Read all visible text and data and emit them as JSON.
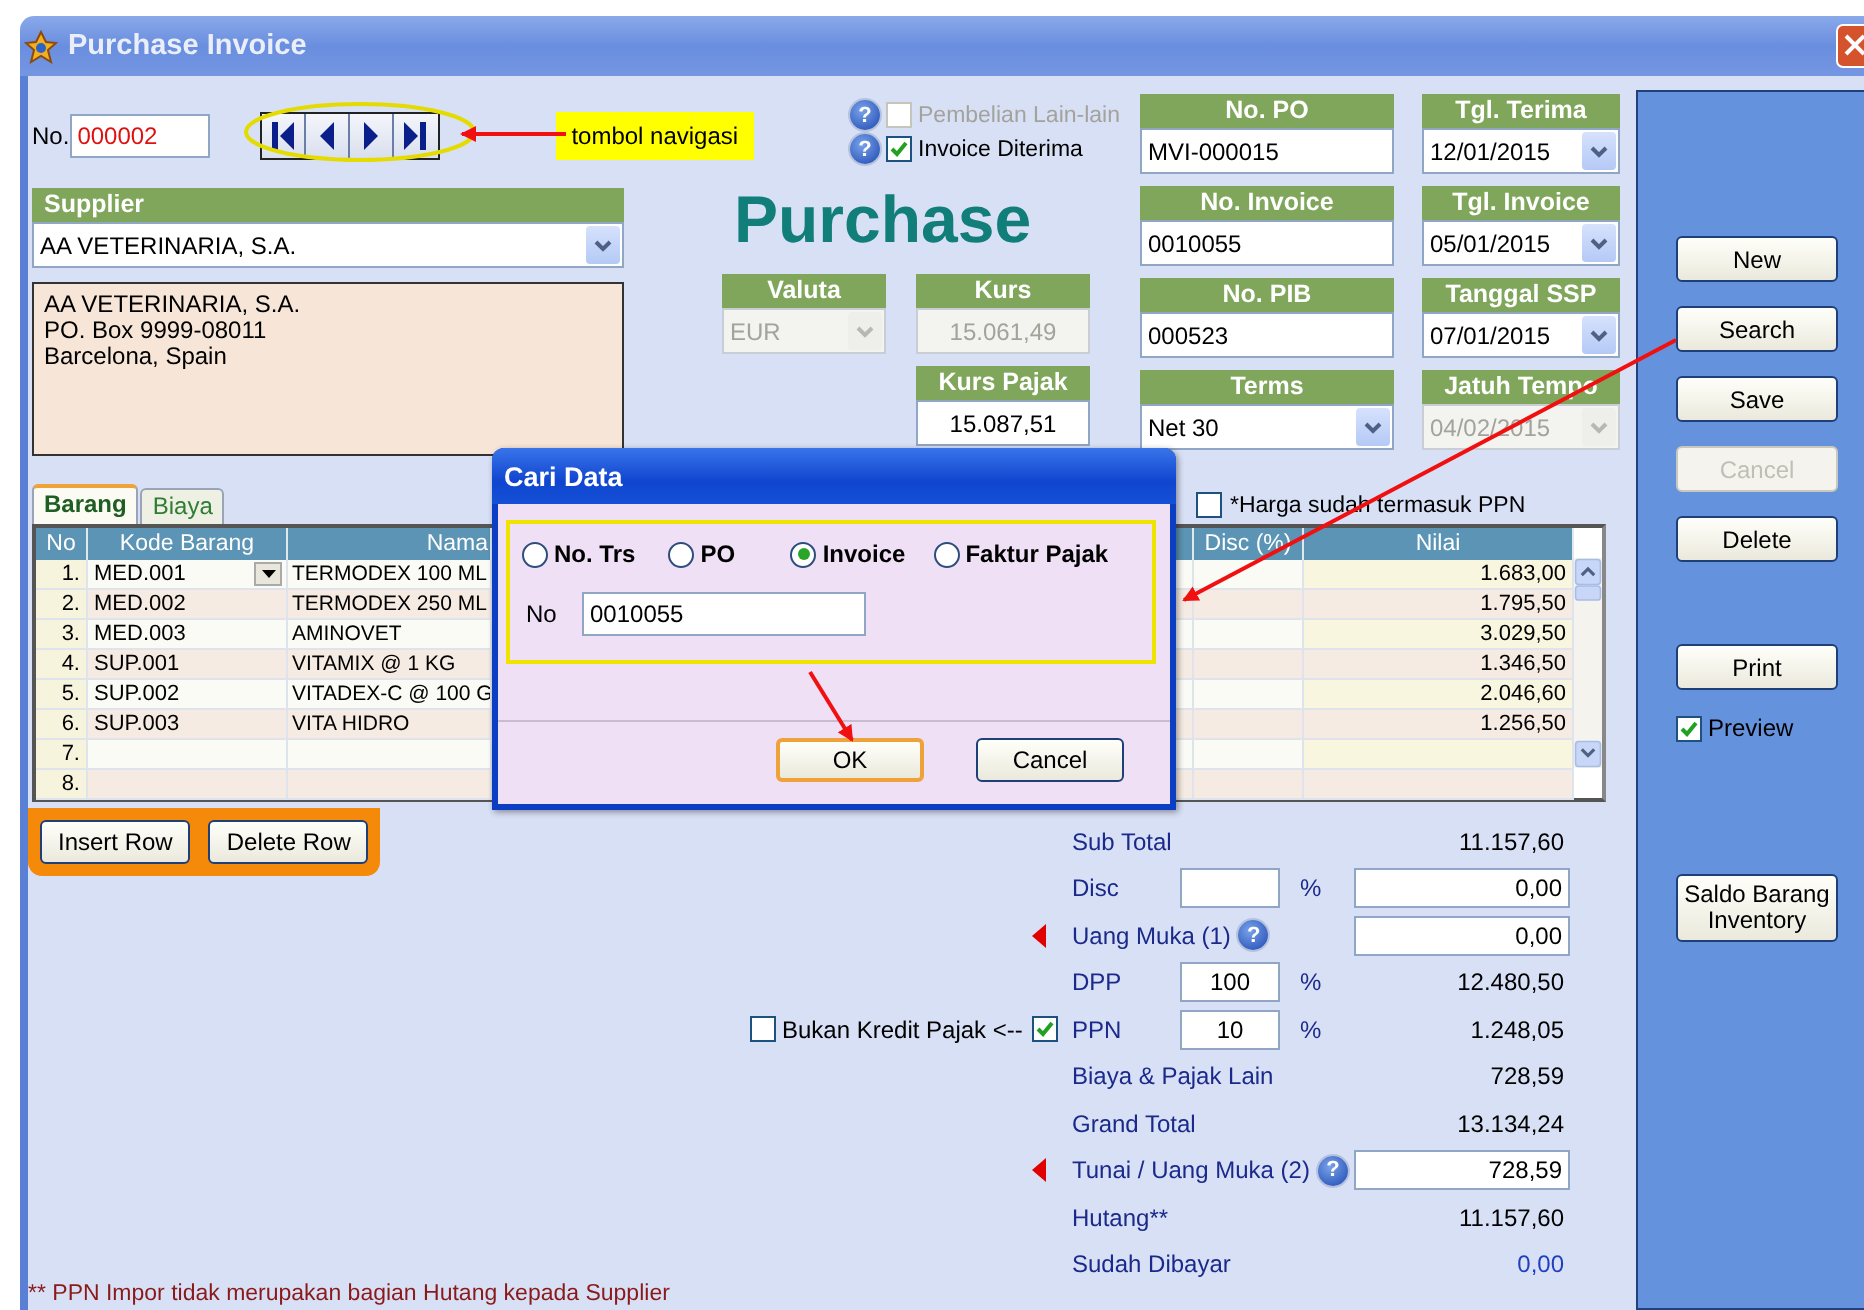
{
  "window": {
    "title": "Purchase Invoice"
  },
  "record": {
    "no_label": "No.",
    "no_value": "000002",
    "nav_note": "tombol navigasi"
  },
  "options": [
    {
      "label": "Pembelian Lain-lain",
      "help": "?",
      "checked": false,
      "disabled": true
    },
    {
      "label": "Invoice Diterima",
      "help": "?",
      "checked": true,
      "disabled": false
    }
  ],
  "supplier": {
    "label": "Supplier",
    "value": "AA VETERINARIA, S.A.",
    "address": [
      "AA VETERINARIA, S.A.",
      "PO. Box 9999-08011",
      "Barcelona, Spain"
    ]
  },
  "form_title": "Purchase",
  "currency_fields": [
    {
      "label": "Valuta",
      "value": "EUR",
      "kind": "select",
      "disabled": true
    },
    {
      "label": "Kurs",
      "value": "15.061,49",
      "kind": "text",
      "disabled": true
    },
    {
      "label": "Kurs Pajak",
      "value": "15.087,51",
      "kind": "text",
      "disabled": false
    }
  ],
  "document_fields": [
    {
      "label": "No. PO",
      "value": "MVI-000015",
      "kind": "text",
      "disabled": false
    },
    {
      "label": "No. Invoice",
      "value": "0010055",
      "kind": "text",
      "disabled": false
    },
    {
      "label": "No. PIB",
      "value": "000523",
      "kind": "text",
      "disabled": false
    },
    {
      "label": "Terms",
      "value": "Net 30",
      "kind": "select",
      "disabled": false
    }
  ],
  "date_fields": [
    {
      "label": "Tgl. Terima",
      "value": "12/01/2015",
      "kind": "select",
      "disabled": false
    },
    {
      "label": "Tgl. Invoice",
      "value": "05/01/2015",
      "kind": "select",
      "disabled": false
    },
    {
      "label": "Tanggal SSP",
      "value": "07/01/2015",
      "kind": "select",
      "disabled": false
    },
    {
      "label": "Jatuh Tempo",
      "value": "04/02/2015",
      "kind": "select",
      "disabled": true
    }
  ],
  "tabs": [
    {
      "label": "Barang",
      "selected": true
    },
    {
      "label": "Biaya",
      "selected": false
    }
  ],
  "price_includes_ppn": {
    "label": "*Harga sudah termasuk PPN",
    "checked": false
  },
  "table": {
    "columns": [
      "No",
      "Kode Barang",
      "Nama",
      "Disc (%)",
      "Nilai"
    ],
    "rows": [
      {
        "no": "1.",
        "kode_barang": "MED.001",
        "nama": "TERMODEX 100 ML",
        "nilai": "1.683,00",
        "editing": true
      },
      {
        "no": "2.",
        "kode_barang": "MED.002",
        "nama": "TERMODEX 250 ML",
        "nilai": "1.795,50",
        "editing": false
      },
      {
        "no": "3.",
        "kode_barang": "MED.003",
        "nama": "AMINOVET",
        "nilai": "3.029,50",
        "editing": false
      },
      {
        "no": "4.",
        "kode_barang": "SUP.001",
        "nama": "VITAMIX @ 1 KG",
        "nilai": "1.346,50",
        "editing": false
      },
      {
        "no": "5.",
        "kode_barang": "SUP.002",
        "nama": "VITADEX-C @ 100 G",
        "nilai": "2.046,60",
        "editing": false
      },
      {
        "no": "6.",
        "kode_barang": "SUP.003",
        "nama": "VITA HIDRO",
        "nilai": "1.256,50",
        "editing": false
      },
      {
        "no": "7.",
        "editing": false
      },
      {
        "no": "8.",
        "editing": false
      }
    ]
  },
  "row_buttons": [
    {
      "label": "Insert Row"
    },
    {
      "label": "Delete Row"
    }
  ],
  "totals": [
    {
      "kind": "amount",
      "label": "Sub Total",
      "marker": false,
      "value": "11.157,60"
    },
    {
      "kind": "percent",
      "label": "Disc",
      "marker": false,
      "unit": "%",
      "value_field": "0,00"
    },
    {
      "kind": "entry",
      "label": "Uang Muka (1)",
      "marker": true,
      "help": "?",
      "value_field": "0,00"
    },
    {
      "kind": "percent",
      "label": "DPP",
      "marker": false,
      "percent": "100",
      "unit": "%",
      "value": "12.480,50"
    },
    {
      "kind": "percent",
      "label": "PPN",
      "marker": false,
      "checked": true,
      "percent": "10",
      "unit": "%",
      "value": "1.248,05",
      "side_check": {
        "label": "Bukan Kredit Pajak <--",
        "checked": false
      }
    },
    {
      "kind": "amount",
      "label": "Biaya & Pajak Lain",
      "marker": false,
      "value": "728,59"
    },
    {
      "kind": "amount",
      "label": "Grand Total",
      "marker": false,
      "value": "13.134,24"
    },
    {
      "kind": "entry",
      "label": "Tunai / Uang Muka (2)",
      "marker": true,
      "help": "?",
      "value_field": "728,59"
    },
    {
      "kind": "amount",
      "label": "Hutang**",
      "marker": false,
      "value": "11.157,60"
    },
    {
      "kind": "amount",
      "label": "Sudah Dibayar",
      "marker": false,
      "value": "0,00",
      "color": "#1f3fc0"
    }
  ],
  "footnote": "** PPN Impor tidak merupakan bagian Hutang kepada Supplier",
  "side_panel": {
    "buttons": [
      {
        "label": "New",
        "disabled": false
      },
      {
        "label": "Search",
        "disabled": false
      },
      {
        "label": "Save",
        "disabled": false
      },
      {
        "label": "Cancel",
        "disabled": true
      },
      {
        "label": "Delete",
        "disabled": false
      }
    ],
    "print": {
      "label": "Print"
    },
    "preview": {
      "label": "Preview",
      "checked": true
    },
    "inventory": {
      "label": "Saldo Barang Inventory"
    }
  },
  "dialog": {
    "title": "Cari Data",
    "search_by": [
      {
        "label": "No. Trs",
        "selected": false
      },
      {
        "label": "PO",
        "selected": false
      },
      {
        "label": "Invoice",
        "selected": true
      },
      {
        "label": "Faktur Pajak",
        "selected": false
      }
    ],
    "no_label": "No",
    "no_value": "0010055",
    "buttons": [
      {
        "label": "OK",
        "focused": true
      },
      {
        "label": "Cancel",
        "focused": false
      }
    ]
  }
}
